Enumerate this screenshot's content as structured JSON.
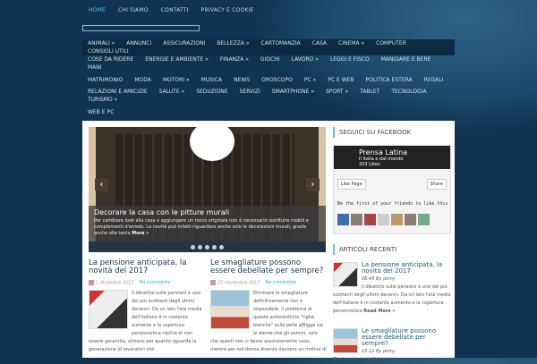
{
  "topnav": [
    "HOME",
    "CHI SIAMO",
    "CONTATTI",
    "PRIVACY E COOKIE"
  ],
  "menu": [
    [
      "ANIMALI »",
      "ANNUNCI",
      "ASSICURAZIONI",
      "BELLEZZA »",
      "CARTOMANZIA",
      "CASA",
      "CINEMA »",
      "COMPUTER",
      "CONSIGLI UTILI"
    ],
    [
      "COSE DA RIDERE",
      "ENERGIE E AMBIENTE »",
      "FINANZA »",
      "GIOCHI",
      "LAVORO »",
      "LEGGI E FISCO",
      "MANGIARE E BERE",
      "MANI"
    ],
    [
      "MATRIMONIO",
      "MODA",
      "MOTORI »",
      "MUSICA",
      "NEWS",
      "OROSCOPO",
      "PC »",
      "PC E WEB",
      "POLITICA ESTERA",
      "REGALI"
    ],
    [
      "RELAZIONI E AMICIZIE",
      "SALUTE »",
      "SEDUZIONE",
      "SERVIZI",
      "SMARTPHONE »",
      "SPORT »",
      "TABLET",
      "TECNOLOGIA",
      "TURISMO »"
    ],
    [
      "WEB E PC"
    ]
  ],
  "slider": {
    "title": "Decorare la casa con le pitture murali",
    "text": "Per cambiare look alla casa e aggiungere un tocco originale non è necessario sostituire mobili e complementi d'arredo. La novità può infatti riguardare anche solo le decorazioni murali, grazie anche alla tanta",
    "more": "More »",
    "prev": "‹",
    "next": "›"
  },
  "posts": [
    {
      "title": "La pensione anticipata, la novità del 2017",
      "date": "1 dicembre 2017",
      "comments": "No comments",
      "text": "Il dibattito sulle pensioni è uno dei più scottanti degli ultimi decenni. Da un lato l'età media dell'italiano è in costante aumento e la copertura pensionistica rischia di non essere garantita, almeno per quanto riguarda la generazione di lavoratori che"
    },
    {
      "title": "Le smagliature possono essere debellate per sempre?",
      "date": "25 novembre 2017",
      "comments": "No comments",
      "text": "Eliminare le smagliature definitivamente non è impossibile, il problema di queste antiestetiche \"righe bianche\" sulla pelle affligge sia le donne che gli uomini, solo che questi non ci fanno assolutamente caso, mentre per noi donne diventa davvero un motivo di"
    }
  ],
  "sidebar": {
    "fb_title": "SEGUICI SU FACEBOOK",
    "fb_page": "Prensa Latina",
    "fb_likes": "203 Likes",
    "fb_sub": "Il Italia e dal mondo",
    "fb_like": "Like Page",
    "fb_share": "Share",
    "fb_friends": "Be the first of your friends to like this",
    "recent_title": "ARTICOLI RECENTI",
    "recent": [
      {
        "title": "La pensione anticipata, la novità del 2017",
        "meta": "06:45 By jenny",
        "text": "Il dibattito sulle pensioni è uno dei più scottanti degli ultimi decenni. Da un lato l'età media dell'italiano è in costante aumento e la copertura pensionistica",
        "more": "Read More »"
      },
      {
        "title": "Le smagliature possono essere debellate per sempre?",
        "meta": "15:12 By jenny",
        "text": "Eliminare le smagliature"
      }
    ]
  }
}
